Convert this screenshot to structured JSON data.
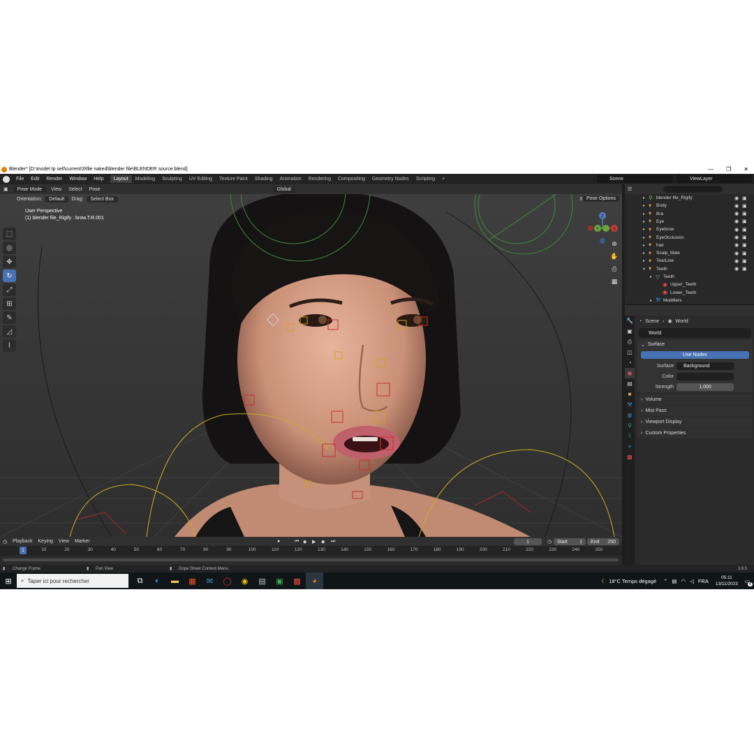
{
  "window": {
    "title": "Blender* [D:\\model tp sell\\current\\3\\file naked\\blender file\\BLENDER source.blend]",
    "controls": [
      "—",
      "❐",
      "✕"
    ]
  },
  "menubar": {
    "menus": [
      "File",
      "Edit",
      "Render",
      "Window",
      "Help"
    ],
    "workspaces": [
      "Layout",
      "Modeling",
      "Sculpting",
      "UV Editing",
      "Texture Paint",
      "Shading",
      "Animation",
      "Rendering",
      "Compositing",
      "Geometry Nodes",
      "Scripting"
    ],
    "add_tab": "+",
    "scene": "Scene",
    "view_layer": "ViewLayer"
  },
  "viewport": {
    "mode": "Pose Mode",
    "menus": [
      "View",
      "Select",
      "Pose"
    ],
    "transform_orientation": "Global",
    "orientation_label": "Orientation:",
    "orientation_value": "Default",
    "drag_label": "Drag:",
    "drag_value": "Select Box",
    "pose_options": "Pose Options",
    "axis_x_label": "X",
    "info_line1": "User Perspective",
    "info_line2": "(1) blender file_Rigify : brow.T.R.001",
    "gizmo_z": "Z",
    "gizmo_y": "Y",
    "gizmo_x": "X"
  },
  "toolbar": {
    "tools": [
      "select-box",
      "cursor",
      "move",
      "rotate",
      "scale",
      "transform",
      "annotate",
      "measure",
      "relax"
    ]
  },
  "outliner": {
    "items": [
      {
        "name": "blender file_Rigify",
        "type": "armature",
        "indent": 1
      },
      {
        "name": "Body",
        "type": "mesh",
        "indent": 1
      },
      {
        "name": "Bra",
        "type": "mesh",
        "indent": 1
      },
      {
        "name": "Eye",
        "type": "mesh",
        "indent": 1
      },
      {
        "name": "Eyebrow",
        "type": "mesh",
        "indent": 1
      },
      {
        "name": "EyeOcclusion",
        "type": "mesh",
        "indent": 1
      },
      {
        "name": "hair",
        "type": "mesh",
        "indent": 1
      },
      {
        "name": "Scalp_Male",
        "type": "mesh",
        "indent": 1
      },
      {
        "name": "TearLine",
        "type": "mesh",
        "indent": 1
      },
      {
        "name": "Teeth",
        "type": "mesh",
        "indent": 1
      },
      {
        "name": "Teeth",
        "type": "data",
        "indent": 2
      },
      {
        "name": "Upper_Teeth",
        "type": "material",
        "indent": 3
      },
      {
        "name": "Lower_Teeth",
        "type": "material",
        "indent": 3
      },
      {
        "name": "Modifiers",
        "type": "modifier",
        "indent": 2
      }
    ]
  },
  "properties": {
    "breadcrumb": [
      "Scene",
      "World"
    ],
    "world_name": "World",
    "surface_panel": "Surface",
    "use_nodes": "Use Nodes",
    "surface_label": "Surface",
    "surface_value": "Background",
    "color_label": "Color",
    "strength_label": "Strength",
    "strength_value": "1.000",
    "sub_panels": [
      "Volume",
      "Mist Pass",
      "Viewport Display",
      "Custom Properties"
    ]
  },
  "timeline": {
    "menus": [
      "Playback",
      "Keying",
      "View",
      "Marker"
    ],
    "current_frame": "1",
    "start_label": "Start",
    "start_value": "1",
    "end_label": "End",
    "end_value": "250",
    "ruler": [
      "10",
      "20",
      "30",
      "40",
      "50",
      "60",
      "70",
      "80",
      "90",
      "100",
      "110",
      "120",
      "130",
      "140",
      "150",
      "160",
      "170",
      "180",
      "190",
      "200",
      "210",
      "220",
      "230",
      "240",
      "250"
    ],
    "playhead": "1"
  },
  "statusbar": {
    "left": "Change Frame",
    "middle": "Pan View",
    "right": "Dope Sheet Context Menu",
    "version": "3.6.5"
  },
  "taskbar": {
    "search_placeholder": "Taper ici pour rechercher",
    "weather": "18°C  Temps dégagé",
    "language": "FRA",
    "time": "05:11",
    "date": "13/11/2023",
    "notification_count": "4"
  }
}
